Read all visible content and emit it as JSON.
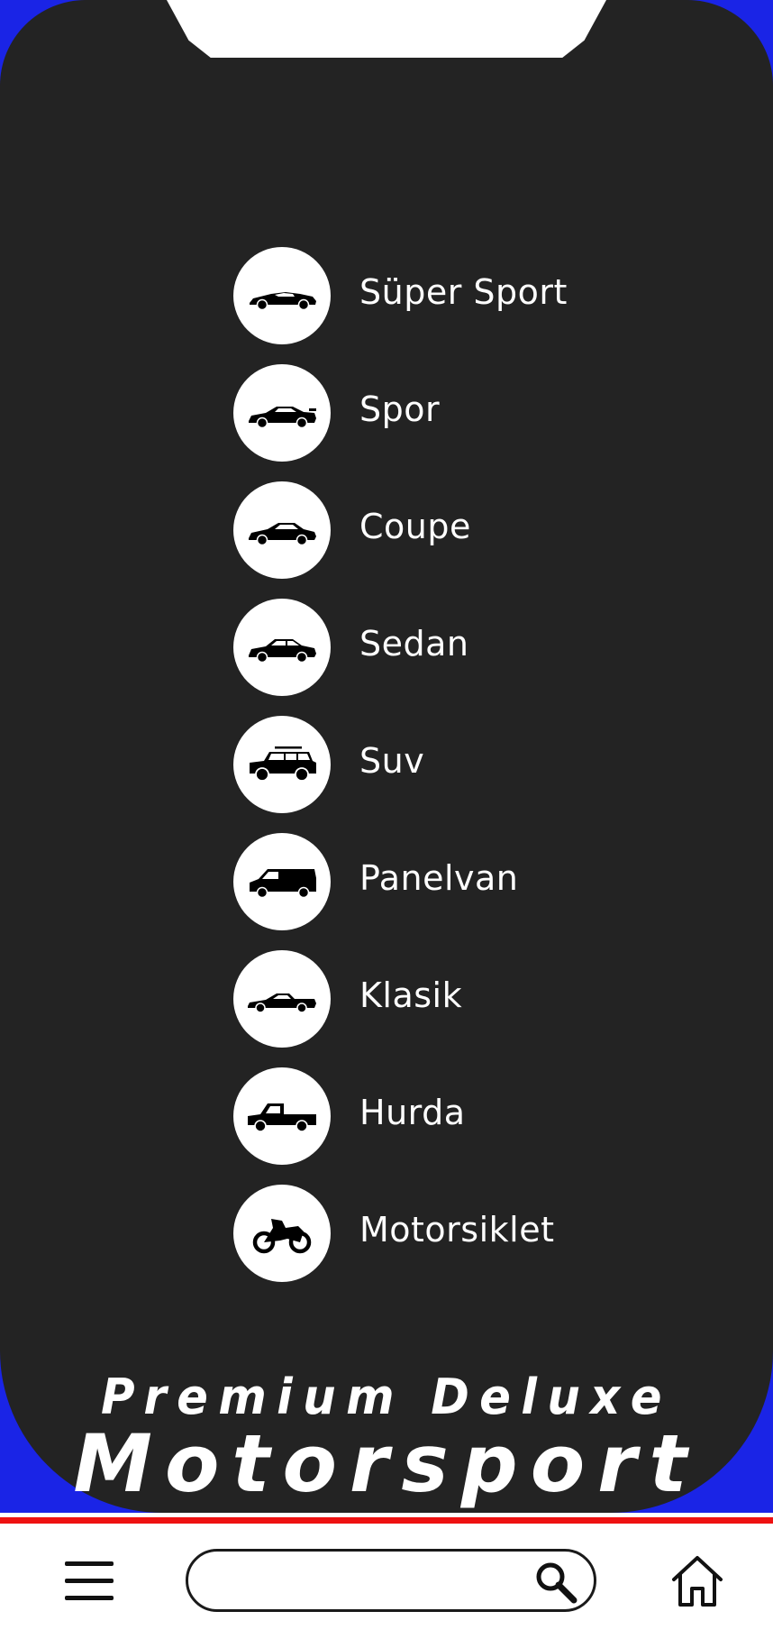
{
  "categories": [
    {
      "label": "Süper Sport",
      "icon": "supercar-icon"
    },
    {
      "label": "Spor",
      "icon": "sportscar-icon"
    },
    {
      "label": "Coupe",
      "icon": "coupe-icon"
    },
    {
      "label": "Sedan",
      "icon": "sedan-icon"
    },
    {
      "label": "Suv",
      "icon": "suv-icon"
    },
    {
      "label": "Panelvan",
      "icon": "van-icon"
    },
    {
      "label": "Klasik",
      "icon": "classic-car-icon"
    },
    {
      "label": "Hurda",
      "icon": "pickup-truck-icon"
    },
    {
      "label": "Motorsiklet",
      "icon": "motorcycle-icon"
    }
  ],
  "brand": {
    "line1": "Premium Deluxe",
    "line2": "Motorsport"
  },
  "search": {
    "placeholder": "",
    "value": ""
  },
  "bottom_bar": {
    "menu_icon": "hamburger-menu-icon",
    "search_icon": "search-icon",
    "home_icon": "home-icon"
  },
  "colors": {
    "panel": "#232323",
    "accent_red": "#ee1111",
    "accent_blue": "#1a24e6",
    "text": "#ffffff"
  }
}
